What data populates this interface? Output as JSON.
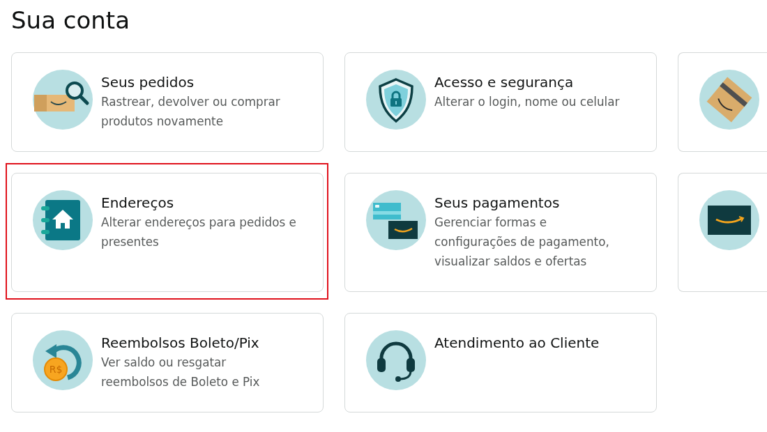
{
  "page": {
    "title": "Sua conta"
  },
  "cards": [
    {
      "kind": "full",
      "title": "Seus pedidos",
      "description": "Rastrear, devolver ou comprar produtos novamente",
      "selected": false
    },
    {
      "kind": "full",
      "title": "Acesso e segurança",
      "description": "Alterar o login, nome ou celular",
      "selected": false
    },
    {
      "kind": "clipped",
      "selected": false
    },
    {
      "kind": "full",
      "title": "Endereços",
      "description": "Alterar endereços para pedidos e presentes",
      "selected": true
    },
    {
      "kind": "full",
      "title": "Seus pagamentos",
      "description": "Gerenciar formas e configurações de pagamento, visualizar saldos e ofertas",
      "selected": false
    },
    {
      "kind": "clipped",
      "selected": false
    },
    {
      "kind": "full",
      "title": "Reembolsos Boleto/Pix",
      "description": "Ver saldo ou resgatar reembolsos de Boleto e Pix",
      "coin_label": "R$",
      "selected": false
    },
    {
      "kind": "full",
      "title": "Atendimento ao Cliente",
      "selected": false
    }
  ]
}
